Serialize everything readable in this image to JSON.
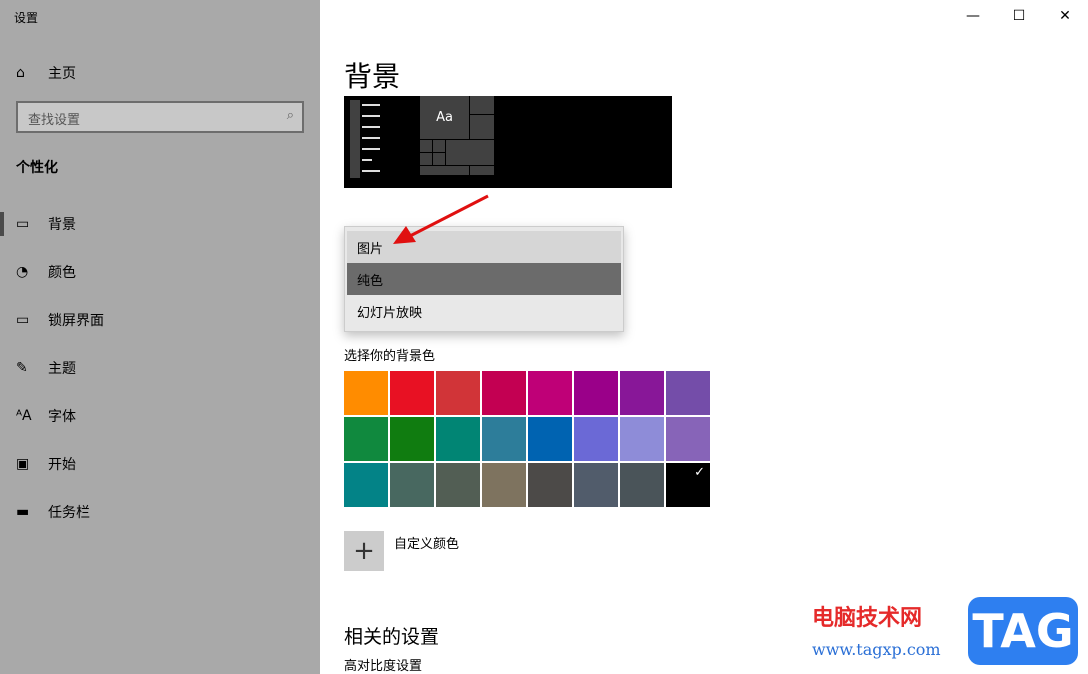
{
  "window": {
    "title": "设置",
    "controls": [
      "minimize",
      "maximize",
      "close"
    ]
  },
  "sidebar": {
    "home": "主页",
    "search_placeholder": "查找设置",
    "section": "个性化",
    "items": [
      {
        "label": "背景",
        "icon": "picture-icon",
        "active": true
      },
      {
        "label": "颜色",
        "icon": "palette-icon"
      },
      {
        "label": "锁屏界面",
        "icon": "lock-screen-icon"
      },
      {
        "label": "主题",
        "icon": "theme-icon"
      },
      {
        "label": "字体",
        "icon": "font-icon"
      },
      {
        "label": "开始",
        "icon": "start-icon"
      },
      {
        "label": "任务栏",
        "icon": "taskbar-icon"
      }
    ]
  },
  "main": {
    "title": "背景",
    "preview_text": "Aa",
    "dropdown": {
      "options": [
        "图片",
        "纯色",
        "幻灯片放映"
      ],
      "selected": "纯色"
    },
    "color_label": "选择你的背景色",
    "colors": [
      "#FF8C00",
      "#E81123",
      "#D13438",
      "#C30052",
      "#BF0077",
      "#9A0089",
      "#881798",
      "#744DA9",
      "#10893E",
      "#107C10",
      "#018574",
      "#2D7D9A",
      "#0063B1",
      "#6B69D6",
      "#8E8CD8",
      "#8764B8",
      "#038387",
      "#486860",
      "#525E54",
      "#7E735F",
      "#4C4A48",
      "#515C6B",
      "#4A5459",
      "#000000"
    ],
    "selected_color": "#000000",
    "custom_color": "自定义颜色",
    "related_title": "相关的设置",
    "related_link": "高对比度设置"
  },
  "watermark": {
    "site_name": "电脑技术网",
    "url": "www.tagxp.com",
    "logo": "TAG"
  }
}
